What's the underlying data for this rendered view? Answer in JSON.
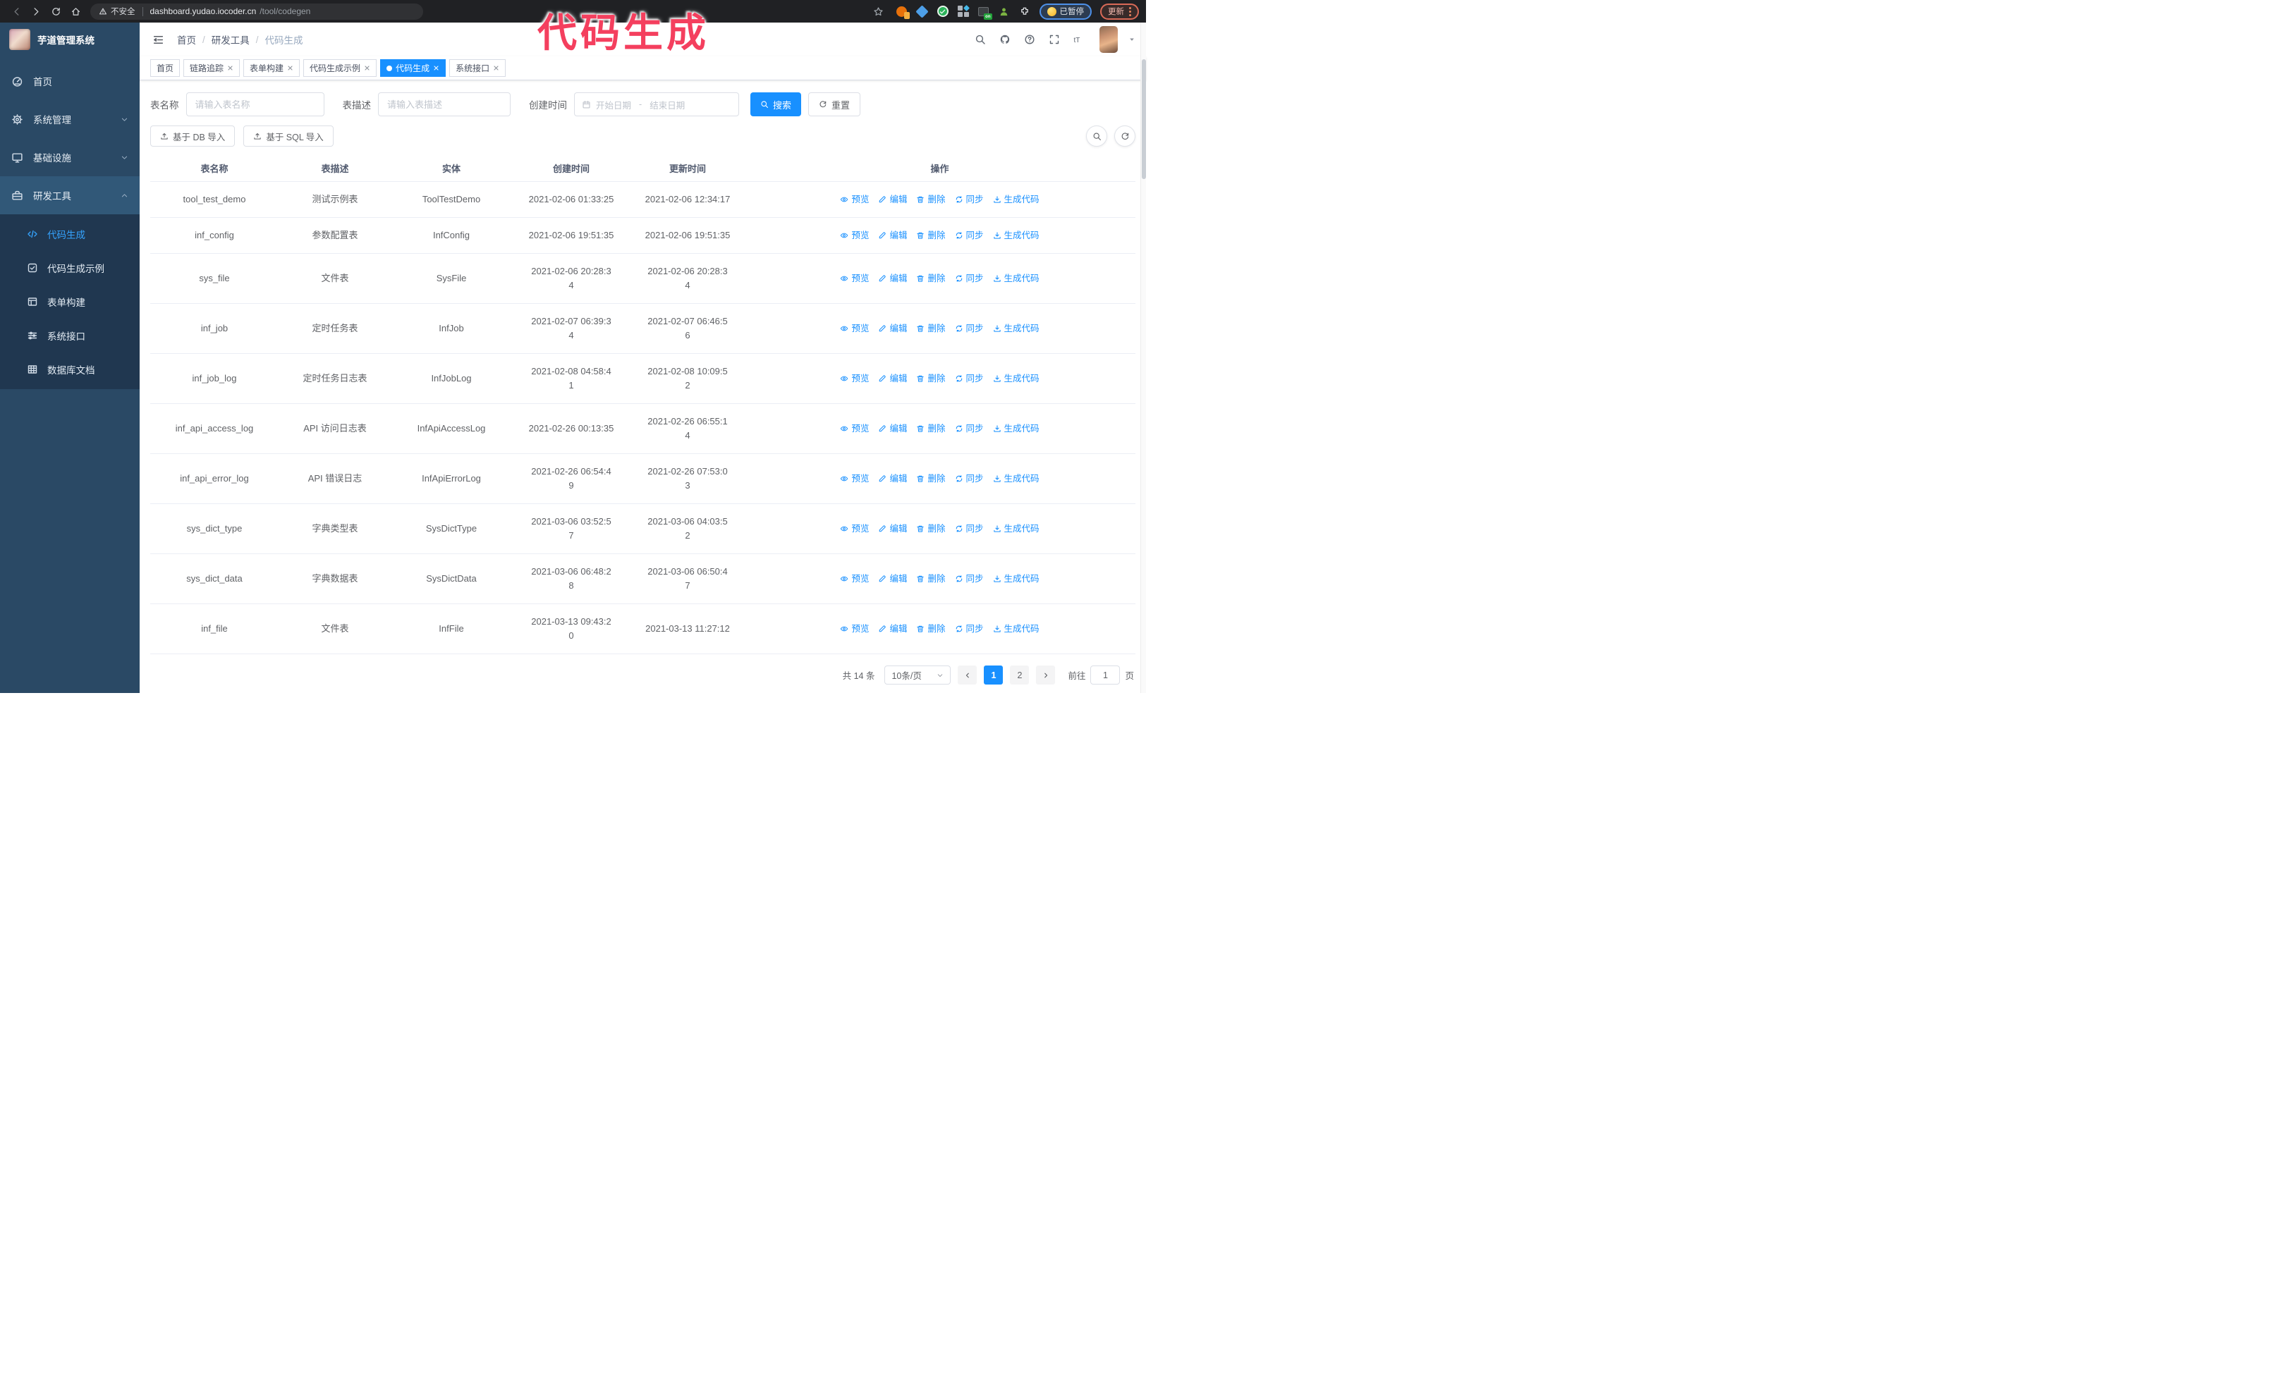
{
  "colors": {
    "accent": "#1890ff",
    "sidebar_bg": "#2a4965",
    "submenu_bg": "#203750",
    "active_parent": "#315878",
    "overlay_pink": "#f43f5e",
    "paused_blue": "#4d90e8",
    "update_red": "#d96a57"
  },
  "browser": {
    "security_label": "不安全",
    "url_host": "dashboard.yudao.iocoder.cn",
    "url_path": "/tool/codegen",
    "on_badge": "on",
    "paused_badge": "已暂停",
    "update_button": "更新"
  },
  "overlay": {
    "title": "代码生成"
  },
  "app": {
    "title": "芋道管理系统",
    "breadcrumb": [
      {
        "label": "首页",
        "sep": false,
        "current": false
      },
      {
        "label": "研发工具",
        "sep": true,
        "current": false
      },
      {
        "label": "代码生成",
        "sep": true,
        "current": true
      }
    ],
    "breadcrumb_separator": "/"
  },
  "tabs": [
    {
      "label": "首页",
      "closable": false,
      "active": false
    },
    {
      "label": "链路追踪",
      "closable": true,
      "active": false
    },
    {
      "label": "表单构建",
      "closable": true,
      "active": false
    },
    {
      "label": "代码生成示例",
      "closable": true,
      "active": false
    },
    {
      "label": "代码生成",
      "closable": true,
      "active": true
    },
    {
      "label": "系统接口",
      "closable": true,
      "active": false
    }
  ],
  "sidebar": {
    "top_items": [
      {
        "label": "首页",
        "icon": "dashboard-icon",
        "has_chevron": false,
        "chevron_up": false,
        "active": false
      },
      {
        "label": "系统管理",
        "icon": "gear-icon",
        "has_chevron": true,
        "chevron_up": false,
        "active": false
      },
      {
        "label": "基础设施",
        "icon": "monitor-icon",
        "has_chevron": true,
        "chevron_up": false,
        "active": false
      },
      {
        "label": "研发工具",
        "icon": "toolbox-icon",
        "has_chevron": true,
        "chevron_up": true,
        "active": true
      }
    ],
    "sub_items": [
      {
        "label": "代码生成",
        "icon": "code-icon",
        "active": true
      },
      {
        "label": "代码生成示例",
        "icon": "example-icon",
        "active": false
      },
      {
        "label": "表单构建",
        "icon": "form-icon",
        "active": false
      },
      {
        "label": "系统接口",
        "icon": "api-icon",
        "active": false
      },
      {
        "label": "数据库文档",
        "icon": "database-doc-icon",
        "active": false
      }
    ]
  },
  "search": {
    "name_label": "表名称",
    "name_placeholder": "请输入表名称",
    "desc_label": "表描述",
    "desc_placeholder": "请输入表描述",
    "time_label": "创建时间",
    "start_placeholder": "开始日期",
    "end_placeholder": "结束日期",
    "range_separator": "-",
    "search_button": "搜索",
    "reset_button": "重置"
  },
  "toolbar": {
    "import_db_button": "基于 DB 导入",
    "import_sql_button": "基于 SQL 导入"
  },
  "table": {
    "headers": {
      "name": "表名称",
      "desc": "表描述",
      "entity": "实体",
      "created": "创建时间",
      "updated": "更新时间",
      "actions": "操作"
    },
    "actions": [
      {
        "name": "preview-action",
        "icon": "eye-icon",
        "label": "预览"
      },
      {
        "name": "edit-action",
        "icon": "edit-icon",
        "label": "编辑"
      },
      {
        "name": "delete-action",
        "icon": "delete-icon",
        "label": "删除"
      },
      {
        "name": "sync-action",
        "icon": "sync-icon",
        "label": "同步"
      },
      {
        "name": "generate-code-action",
        "icon": "download-icon",
        "label": "生成代码"
      }
    ],
    "rows": [
      {
        "name": "tool_test_demo",
        "desc": "测试示例表",
        "entity": "ToolTestDemo",
        "created": "2021-02-06 01:33:25",
        "updated": "2021-02-06 12:34:17"
      },
      {
        "name": "inf_config",
        "desc": "参数配置表",
        "entity": "InfConfig",
        "created": "2021-02-06 19:51:35",
        "updated": "2021-02-06 19:51:35"
      },
      {
        "name": "sys_file",
        "desc": "文件表",
        "entity": "SysFile",
        "created": "2021-02-06 20:28:3\n4",
        "updated": "2021-02-06 20:28:3\n4"
      },
      {
        "name": "inf_job",
        "desc": "定时任务表",
        "entity": "InfJob",
        "created": "2021-02-07 06:39:3\n4",
        "updated": "2021-02-07 06:46:5\n6"
      },
      {
        "name": "inf_job_log",
        "desc": "定时任务日志表",
        "entity": "InfJobLog",
        "created": "2021-02-08 04:58:4\n1",
        "updated": "2021-02-08 10:09:5\n2"
      },
      {
        "name": "inf_api_access_log",
        "desc": "API 访问日志表",
        "entity": "InfApiAccessLog",
        "created": "2021-02-26 00:13:35",
        "updated": "2021-02-26 06:55:1\n4"
      },
      {
        "name": "inf_api_error_log",
        "desc": "API 错误日志",
        "entity": "InfApiErrorLog",
        "created": "2021-02-26 06:54:4\n9",
        "updated": "2021-02-26 07:53:0\n3"
      },
      {
        "name": "sys_dict_type",
        "desc": "字典类型表",
        "entity": "SysDictType",
        "created": "2021-03-06 03:52:5\n7",
        "updated": "2021-03-06 04:03:5\n2"
      },
      {
        "name": "sys_dict_data",
        "desc": "字典数据表",
        "entity": "SysDictData",
        "created": "2021-03-06 06:48:2\n8",
        "updated": "2021-03-06 06:50:4\n7"
      },
      {
        "name": "inf_file",
        "desc": "文件表",
        "entity": "InfFile",
        "created": "2021-03-13 09:43:2\n0",
        "updated": "2021-03-13 11:27:12"
      }
    ]
  },
  "pagination": {
    "total_text": "共 14 条",
    "page_size": "10条/页",
    "pages": [
      {
        "label": "1",
        "active": true
      },
      {
        "label": "2",
        "active": false
      }
    ],
    "goto_label": "前往",
    "goto_value": "1",
    "goto_suffix": "页"
  }
}
